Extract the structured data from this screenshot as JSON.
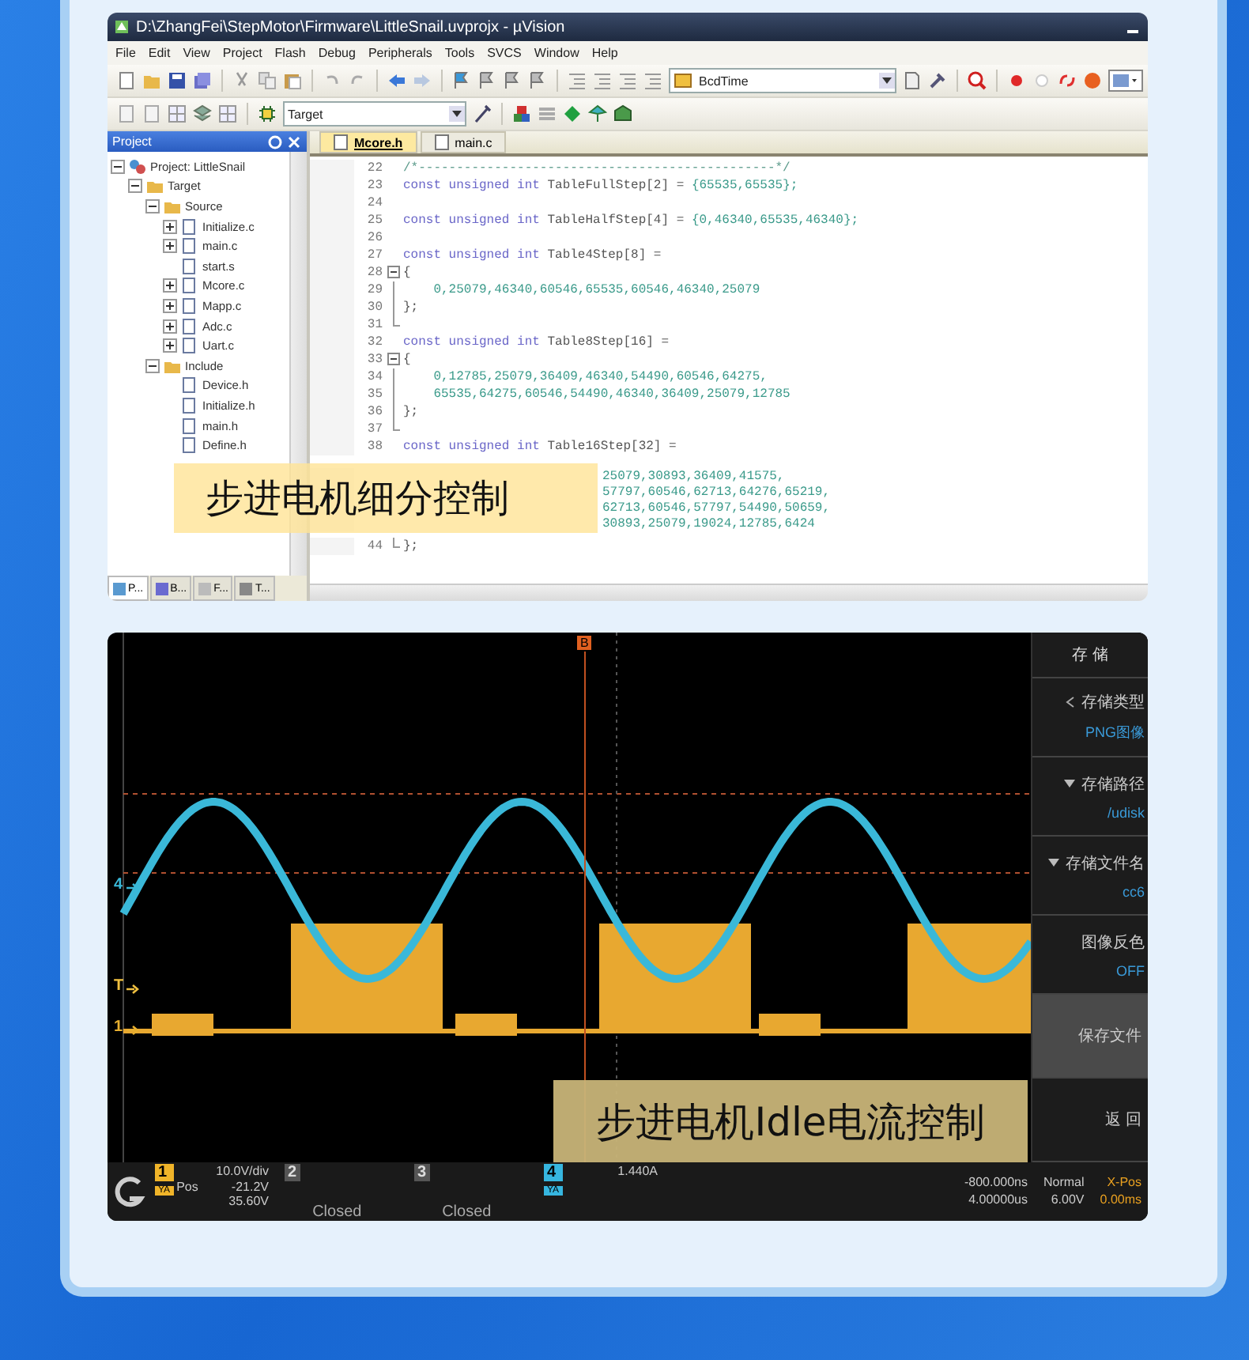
{
  "ide": {
    "title": "D:\\ZhangFei\\StepMotor\\Firmware\\LittleSnail.uvprojx - µVision",
    "menu": [
      "File",
      "Edit",
      "View",
      "Project",
      "Flash",
      "Debug",
      "Peripherals",
      "Tools",
      "SVCS",
      "Window",
      "Help"
    ],
    "function_combo": {
      "value": "BcdTime"
    },
    "target_combo": {
      "value": "Target"
    },
    "project_panel": {
      "title": "Project"
    },
    "tree": [
      {
        "label": "Project: LittleSnail",
        "kind": "project",
        "expanded": true,
        "children": [
          {
            "label": "Target",
            "kind": "target",
            "expanded": true,
            "children": [
              {
                "label": "Source",
                "kind": "folder",
                "expanded": true,
                "children": [
                  {
                    "label": "Initialize.c",
                    "kind": "file",
                    "expanded": false
                  },
                  {
                    "label": "main.c",
                    "kind": "file",
                    "expanded": false
                  },
                  {
                    "label": "start.s",
                    "kind": "file"
                  },
                  {
                    "label": "Mcore.c",
                    "kind": "file",
                    "expanded": false
                  },
                  {
                    "label": "Mapp.c",
                    "kind": "file",
                    "expanded": false
                  },
                  {
                    "label": "Adc.c",
                    "kind": "file",
                    "expanded": false
                  },
                  {
                    "label": "Uart.c",
                    "kind": "file",
                    "expanded": false
                  }
                ]
              },
              {
                "label": "Include",
                "kind": "folder",
                "expanded": true,
                "children": [
                  {
                    "label": "Device.h",
                    "kind": "file"
                  },
                  {
                    "label": "Initialize.h",
                    "kind": "file"
                  },
                  {
                    "label": "main.h",
                    "kind": "file"
                  },
                  {
                    "label": "Define.h",
                    "kind": "file"
                  }
                ]
              }
            ]
          }
        ]
      }
    ],
    "panel_tabs": [
      {
        "label": "P...",
        "selected": true
      },
      {
        "label": "B...",
        "selected": false
      },
      {
        "label": "F...",
        "selected": false
      },
      {
        "label": "T...",
        "selected": false
      }
    ],
    "file_tabs": [
      {
        "label": "Mcore.h",
        "selected": true
      },
      {
        "label": "main.c",
        "selected": false
      }
    ],
    "code": [
      {
        "num": "22",
        "kind": "plain",
        "parts": [
          {
            "kind": "comment",
            "text": "/*-----------------------------------------------*/"
          }
        ]
      },
      {
        "num": "23",
        "kind": "plain",
        "parts": [
          {
            "kind": "kw",
            "text": "const unsigned int"
          },
          {
            "kind": "id",
            "text": " TableFullStep[2] = "
          },
          {
            "kind": "num",
            "text": "{65535,65535};"
          }
        ]
      },
      {
        "num": "24",
        "kind": "plain"
      },
      {
        "num": "25",
        "kind": "plain",
        "parts": [
          {
            "kind": "kw",
            "text": "const unsigned int"
          },
          {
            "kind": "id",
            "text": " TableHalfStep[4] = "
          },
          {
            "kind": "num",
            "text": "{0,46340,65535,46340};"
          }
        ]
      },
      {
        "num": "26",
        "kind": "plain"
      },
      {
        "num": "27",
        "kind": "plain",
        "parts": [
          {
            "kind": "kw",
            "text": "const unsigned int"
          },
          {
            "kind": "id",
            "text": " Table4Step[8] ="
          }
        ]
      },
      {
        "num": "28",
        "kind": "fold-start",
        "parts": [
          {
            "kind": "id",
            "text": "{"
          }
        ]
      },
      {
        "num": "29",
        "kind": "fold-body",
        "parts": [
          {
            "kind": "num",
            "text": "    0,25079,46340,60546,65535,60546,46340,25079"
          }
        ]
      },
      {
        "num": "30",
        "kind": "fold-body",
        "parts": [
          {
            "kind": "id",
            "text": "};"
          }
        ]
      },
      {
        "num": "31",
        "kind": "fold-end"
      },
      {
        "num": "32",
        "kind": "plain",
        "parts": [
          {
            "kind": "kw",
            "text": "const unsigned int"
          },
          {
            "kind": "id",
            "text": " Table8Step[16] ="
          }
        ]
      },
      {
        "num": "33",
        "kind": "fold-start",
        "parts": [
          {
            "kind": "id",
            "text": "{"
          }
        ]
      },
      {
        "num": "34",
        "kind": "fold-body",
        "parts": [
          {
            "kind": "num",
            "text": "    0,12785,25079,36409,46340,54490,60546,64275,"
          }
        ]
      },
      {
        "num": "35",
        "kind": "fold-body",
        "parts": [
          {
            "kind": "num",
            "text": "    65535,64275,60546,54490,46340,36409,25079,12785"
          }
        ]
      },
      {
        "num": "36",
        "kind": "fold-body",
        "parts": [
          {
            "kind": "id",
            "text": "};"
          }
        ]
      },
      {
        "num": "37",
        "kind": "fold-end"
      },
      {
        "num": "38",
        "kind": "plain",
        "parts": [
          {
            "kind": "kw",
            "text": "const unsigned int"
          },
          {
            "kind": "id",
            "text": " Table16Step[32] ="
          }
        ]
      },
      {
        "kind": "tail",
        "parts": [
          {
            "kind": "num",
            "text": "25079,30893,36409,41575,"
          }
        ]
      },
      {
        "kind": "tail",
        "parts": [
          {
            "kind": "num",
            "text": "57797,60546,62713,64276,65219,"
          }
        ]
      },
      {
        "kind": "tail",
        "parts": [
          {
            "kind": "num",
            "text": "62713,60546,57797,54490,50659,"
          }
        ]
      },
      {
        "kind": "tail",
        "parts": [
          {
            "kind": "num",
            "text": "30893,25079,19024,12785,6424"
          }
        ]
      },
      {
        "num": "44",
        "kind": "fold-end",
        "parts": [
          {
            "kind": "id",
            "text": "};"
          }
        ]
      }
    ],
    "caption": "步进电机细分控制"
  },
  "scope": {
    "cursor_marker": "B",
    "trace_markers": [
      {
        "label": "4",
        "color": "#3ab8d8"
      },
      {
        "label": "T",
        "color": "#f0c040"
      },
      {
        "label": "1",
        "color": "#e8b030"
      }
    ],
    "panel": {
      "title": "存 储",
      "items": [
        {
          "label": "存储类型",
          "value": "PNG图像",
          "kind": "submenu"
        },
        {
          "label": "存储路径",
          "value": "/udisk",
          "kind": "dropdown"
        },
        {
          "label": "存储文件名",
          "value": "cc6",
          "kind": "dropdown"
        },
        {
          "label": "图像反色",
          "value": "OFF",
          "kind": "plain"
        }
      ],
      "actions": [
        {
          "label": "保存文件",
          "highlighted": true
        },
        {
          "label": "返 回",
          "highlighted": false
        }
      ]
    },
    "channels": [
      {
        "label": "1",
        "kind": "active",
        "color": "#f0b429",
        "scale": "10.0V/div",
        "pos_label": "Pos",
        "pos": "-21.2V",
        "unit": "YA",
        "value": "35.60V"
      },
      {
        "label": "2",
        "kind": "closed",
        "status": "Closed"
      },
      {
        "label": "3",
        "kind": "closed",
        "status": "Closed"
      },
      {
        "label": "4",
        "kind": "active",
        "color": "#36b6e0",
        "unit": "YA",
        "value": "1.440A"
      }
    ],
    "timebase": {
      "offset": "-800.000ns",
      "scale": "4.00000us",
      "mode": "Normal",
      "level": "6.00V",
      "xpos_label": "X-Pos",
      "xpos": "0.00ms"
    },
    "caption": "步进电机Idle电流控制"
  }
}
